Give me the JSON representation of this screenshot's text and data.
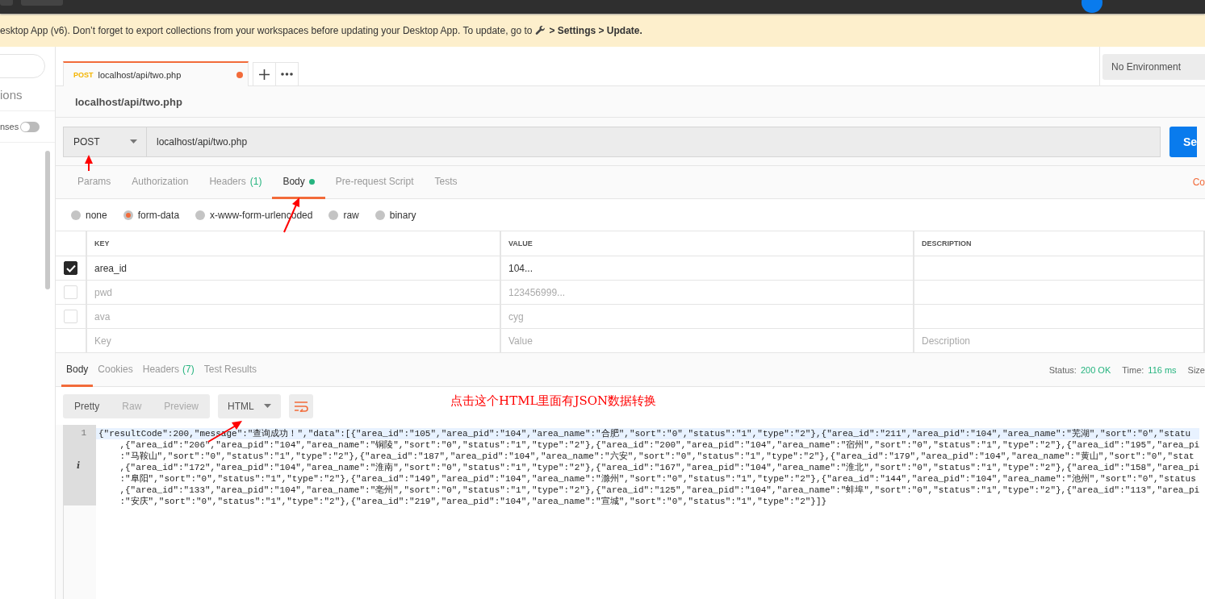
{
  "banner": {
    "text": "esktop App (v6). Don’t forget to export collections from your workspaces before updating your Desktop App. To update, go to",
    "path": "> Settings > Update."
  },
  "sidebar": {
    "section": "ions",
    "toggle": {
      "label": "nses",
      "on": false
    }
  },
  "tab": {
    "method": "POST",
    "url": "localhost/api/two.php",
    "unsaved": true
  },
  "environment": "No Environment",
  "request": {
    "title": "localhost/api/two.php",
    "method": "POST",
    "url": "localhost/api/two.php",
    "send": "Se"
  },
  "request_tabs": [
    {
      "label": "Params",
      "selected": false
    },
    {
      "label": "Authorization",
      "selected": false
    },
    {
      "label": "Headers",
      "badge": "(1)",
      "selected": false
    },
    {
      "label": "Body",
      "dot": true,
      "selected": true
    },
    {
      "label": "Pre-request Script",
      "selected": false
    },
    {
      "label": "Tests",
      "selected": false
    }
  ],
  "cookies_link": "Co",
  "body_types": [
    {
      "label": "none",
      "selected": false
    },
    {
      "label": "form-data",
      "selected": true
    },
    {
      "label": "x-www-form-urlencoded",
      "selected": false
    },
    {
      "label": "raw",
      "selected": false
    },
    {
      "label": "binary",
      "selected": false
    }
  ],
  "params": {
    "columns": [
      "KEY",
      "VALUE",
      "DESCRIPTION"
    ],
    "rows": [
      {
        "key": "area_id",
        "value": "104...",
        "checked": true
      },
      {
        "key": "pwd",
        "value": "123456999...",
        "checked": false
      },
      {
        "key": "ava",
        "value": "cyg",
        "checked": false
      }
    ],
    "new_row": {
      "key": {
        "placeholder": "Key"
      },
      "value": {
        "placeholder": "Value"
      },
      "description": {
        "placeholder": "Description"
      }
    }
  },
  "response_tabs": [
    {
      "label": "Body",
      "selected": true
    },
    {
      "label": "Cookies",
      "selected": false
    },
    {
      "label": "Headers",
      "badge": "(7)",
      "selected": false
    },
    {
      "label": "Test Results",
      "selected": false
    }
  ],
  "status": {
    "status_label": "Status:",
    "status": "200 OK",
    "time_label": "Time:",
    "time": "116 ms",
    "size_label": "Size"
  },
  "view_modes": [
    {
      "label": "Pretty",
      "selected": true
    },
    {
      "label": "Raw",
      "selected": false
    },
    {
      "label": "Preview",
      "selected": false
    }
  ],
  "format": "HTML",
  "annotation": "点击这个HTML里面有JSON数据转换",
  "code": {
    "line_number": "1",
    "gutter_marker": "i",
    "lines": [
      "{\"resultCode\":200,\"message\":\"查询成功！\",\"data\":[{\"area_id\":\"105\",\"area_pid\":\"104\",\"area_name\":\"合肥\",\"sort\":\"0\",\"status\":\"1\",\"type\":\"2\"},{\"area_id\":\"211\",\"area_pid\":\"104\",\"area_name\":\"芜湖\",\"sort\":\"0\",\"statu",
      "    ,{\"area_id\":\"206\",\"area_pid\":\"104\",\"area_name\":\"铜陵\",\"sort\":\"0\",\"status\":\"1\",\"type\":\"2\"},{\"area_id\":\"200\",\"area_pid\":\"104\",\"area_name\":\"宿州\",\"sort\":\"0\",\"status\":\"1\",\"type\":\"2\"},{\"area_id\":\"195\",\"area_pi",
      "    :\"马鞍山\",\"sort\":\"0\",\"status\":\"1\",\"type\":\"2\"},{\"area_id\":\"187\",\"area_pid\":\"104\",\"area_name\":\"六安\",\"sort\":\"0\",\"status\":\"1\",\"type\":\"2\"},{\"area_id\":\"179\",\"area_pid\":\"104\",\"area_name\":\"黄山\",\"sort\":\"0\",\"stat",
      "    ,{\"area_id\":\"172\",\"area_pid\":\"104\",\"area_name\":\"淮南\",\"sort\":\"0\",\"status\":\"1\",\"type\":\"2\"},{\"area_id\":\"167\",\"area_pid\":\"104\",\"area_name\":\"淮北\",\"sort\":\"0\",\"status\":\"1\",\"type\":\"2\"},{\"area_id\":\"158\",\"area_pi",
      "    :\"阜阳\",\"sort\":\"0\",\"status\":\"1\",\"type\":\"2\"},{\"area_id\":\"149\",\"area_pid\":\"104\",\"area_name\":\"滁州\",\"sort\":\"0\",\"status\":\"1\",\"type\":\"2\"},{\"area_id\":\"144\",\"area_pid\":\"104\",\"area_name\":\"池州\",\"sort\":\"0\",\"status",
      "    ,{\"area_id\":\"133\",\"area_pid\":\"104\",\"area_name\":\"亳州\",\"sort\":\"0\",\"status\":\"1\",\"type\":\"2\"},{\"area_id\":\"125\",\"area_pid\":\"104\",\"area_name\":\"蚌埠\",\"sort\":\"0\",\"status\":\"1\",\"type\":\"2\"},{\"area_id\":\"113\",\"area_pi",
      "    :\"安庆\",\"sort\":\"0\",\"status\":\"1\",\"type\":\"2\"},{\"area_id\":\"219\",\"area_pid\":\"104\",\"area_name\":\"宣城\",\"sort\":\"0\",\"status\":\"1\",\"type\":\"2\"}]}"
    ]
  }
}
